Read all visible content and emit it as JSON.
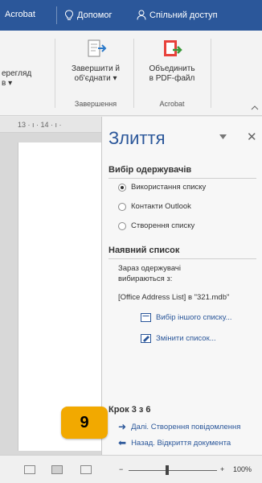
{
  "tabbar": {
    "acrobat_label": "Acrobat",
    "help_label": "Допомог",
    "share_label": "Спільний доступ"
  },
  "ribbon": {
    "preview_label": "ерегляд",
    "preview_sub": "в ▾",
    "finish_label_1": "Завершити й",
    "finish_label_2": "об'єднати ▾",
    "finish_group": "Завершення",
    "pdf_label_1": "Объединить",
    "pdf_label_2": "в PDF-файл",
    "pdf_group": "Acrobat"
  },
  "ruler": {
    "text": "13 · ı · 14 · ı ·"
  },
  "pane": {
    "title": "Злиття",
    "section_recipients": "Вибір одержувачів",
    "radio_options": [
      "Використання списку",
      "Контакти Outlook",
      "Створення списку"
    ],
    "section_list": "Наявний список",
    "list_text_1": "Зараз одержувачі",
    "list_text_2": "вибираються з:",
    "list_source": "[Office Address List] в \"321.mdb\"",
    "link_other_list": "Вибір іншого списку...",
    "link_change_list": "Змінити список...",
    "step_label": "Крок 3 з 6",
    "next_link": "Далі. Створення повідомлення",
    "back_link": "Назад. Відкриття документа"
  },
  "badge": {
    "number": "9"
  },
  "statusbar": {
    "zoom": "100%",
    "minus": "−",
    "plus": "+"
  },
  "icons": {
    "lightbulb": "lightbulb-icon",
    "person": "person-icon"
  }
}
